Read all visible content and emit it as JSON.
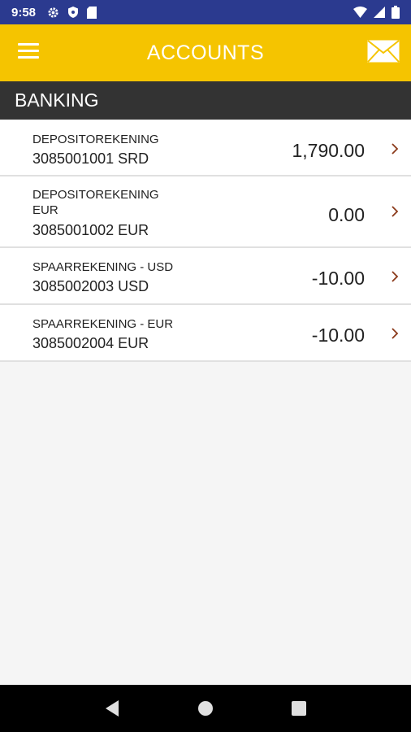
{
  "status_bar": {
    "time": "9:58"
  },
  "app_bar": {
    "title": "ACCOUNTS"
  },
  "section": {
    "title": "BANKING"
  },
  "accounts": [
    {
      "name": "DEPOSITOREKENING",
      "number": "3085001001 SRD",
      "balance": "1,790.00"
    },
    {
      "name": "DEPOSITOREKENING EUR",
      "number": "3085001002 EUR",
      "balance": "0.00"
    },
    {
      "name": "SPAARREKENING - USD",
      "number": "3085002003 USD",
      "balance": "-10.00"
    },
    {
      "name": "SPAARREKENING - EUR",
      "number": "3085002004 EUR",
      "balance": "-10.00"
    }
  ],
  "colors": {
    "status_bar": "#2b3a8f",
    "app_bar": "#f5c400",
    "section_header": "#333333",
    "chevron": "#8b3a1a"
  }
}
